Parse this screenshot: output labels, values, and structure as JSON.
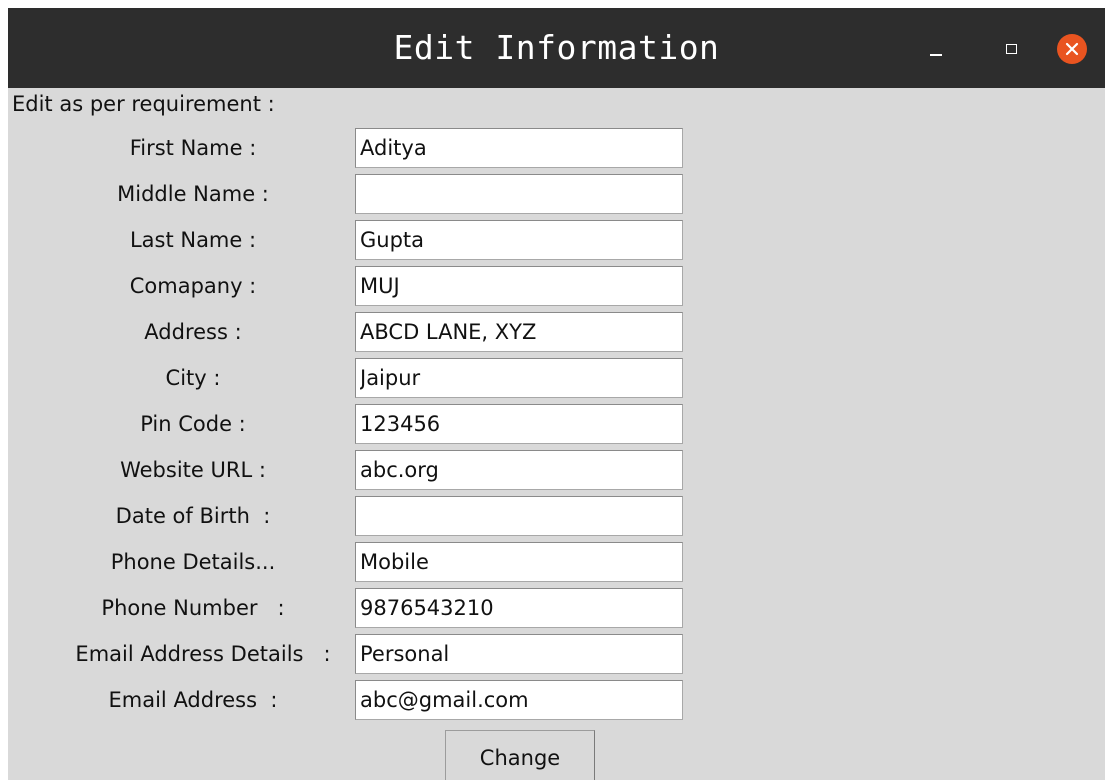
{
  "window": {
    "title": "Edit Information",
    "title_bar_color": "#2d2d2d",
    "close_button_color": "#e95420",
    "controls": [
      "minimize-icon",
      "maximize-icon",
      "close-icon"
    ]
  },
  "form": {
    "subtitle": "Edit as per requirement :",
    "fields": [
      {
        "label": "First Name :",
        "value": "Aditya"
      },
      {
        "label": "Middle Name :",
        "value": ""
      },
      {
        "label": "Last Name :",
        "value": "Gupta"
      },
      {
        "label": "Comapany :",
        "value": "MUJ"
      },
      {
        "label": "Address :",
        "value": "ABCD LANE, XYZ"
      },
      {
        "label": "City :",
        "value": "Jaipur"
      },
      {
        "label": "Pin Code :",
        "value": "123456"
      },
      {
        "label": "Website URL :",
        "value": "abc.org"
      },
      {
        "label": "Date of Birth  :",
        "value": ""
      },
      {
        "label": "Phone Details...",
        "value": "Mobile"
      },
      {
        "label": "Phone Number   :",
        "value": "9876543210"
      },
      {
        "label": "Email Address Details   :",
        "value": "Personal"
      },
      {
        "label": "Email Address  :",
        "value": "abc@gmail.com"
      }
    ],
    "submit_label": "Change"
  }
}
